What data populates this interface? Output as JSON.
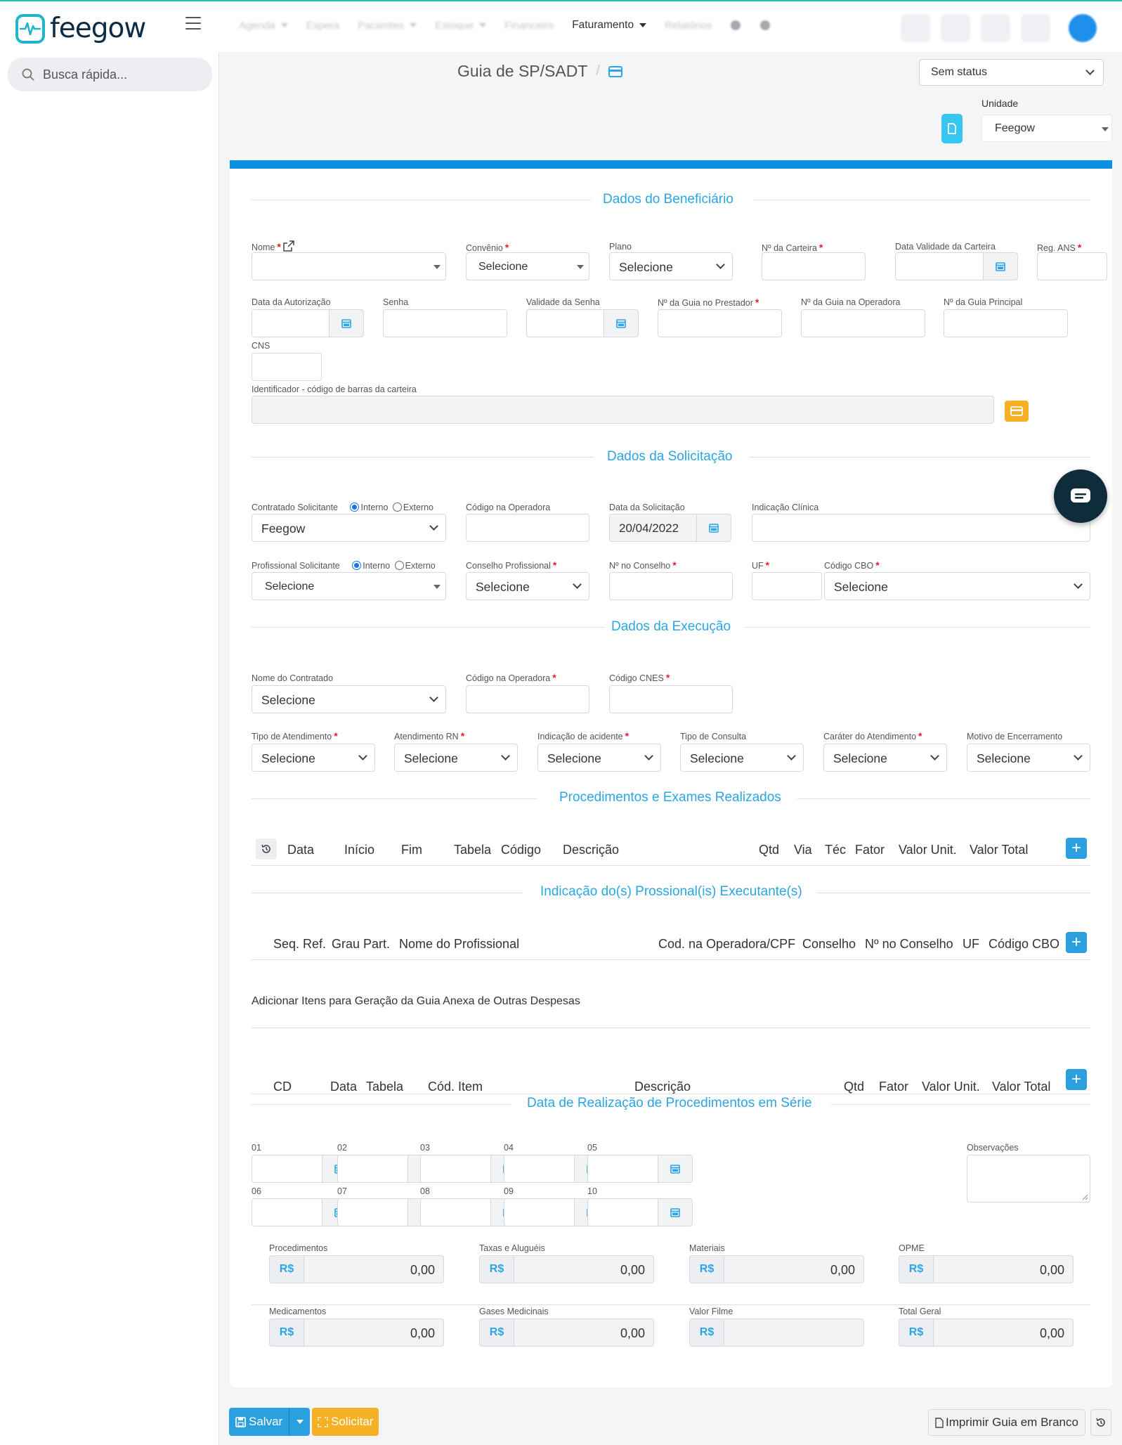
{
  "app": {
    "logo_text": "feegow",
    "brand_color": "#1fb6c9",
    "accent_color": "#2ba5e3"
  },
  "nav": {
    "items": [
      "Agenda",
      "Espera",
      "Pacientes",
      "Estoque",
      "Financeiro",
      "Faturamento",
      "Relatórios"
    ],
    "active": "Faturamento"
  },
  "sidebar": {
    "search_placeholder": "Busca rápida..."
  },
  "page": {
    "title": "Guia de SP/SADT",
    "status": "Sem status",
    "unidade_label": "Unidade",
    "unidade_value": "Feegow"
  },
  "sections": {
    "beneficiario": "Dados do Beneficiário",
    "solicitacao": "Dados da Solicitação",
    "execucao": "Dados da Execução",
    "procedimentos": "Procedimentos e Exames Realizados",
    "profissionais": "Indicação do(s) Prossional(is) Executante(s)",
    "serie": "Data de Realização de Procedimentos em Série"
  },
  "beneficiario": {
    "nome": "Nome",
    "convenio": "Convênio",
    "convenio_value": "Selecione",
    "plano": "Plano",
    "plano_value": "Selecione",
    "carteira": "Nº da Carteira",
    "validade_carteira": "Data Validade da Carteira",
    "reg_ans": "Reg. ANS",
    "data_autorizacao": "Data da Autorização",
    "senha": "Senha",
    "validade_senha": "Validade da Senha",
    "guia_prestador": "Nº da Guia no Prestador",
    "guia_operadora": "Nº da Guia na Operadora",
    "guia_principal": "Nº da Guia Principal",
    "cns": "CNS",
    "identificador": "Identificador - código de barras da carteira"
  },
  "solicitacao": {
    "contratado": "Contratado Solicitante",
    "interno": "Interno",
    "externo": "Externo",
    "contratado_value": "Feegow",
    "codigo_operadora": "Código na Operadora",
    "data_solicitacao": "Data da Solicitação",
    "data_solicitacao_value": "20/04/2022",
    "indicacao_clinica": "Indicação Clínica",
    "profissional": "Profissional Solicitante",
    "profissional_value": "Selecione",
    "conselho": "Conselho Profissional",
    "conselho_value": "Selecione",
    "n_conselho": "Nº no Conselho",
    "uf": "UF",
    "cbo": "Código CBO",
    "cbo_value": "Selecione"
  },
  "execucao": {
    "nome_contratado": "Nome do Contratado",
    "nome_contratado_value": "Selecione",
    "codigo_operadora": "Código na Operadora",
    "codigo_cnes": "Código CNES",
    "tipo_atendimento": "Tipo de Atendimento",
    "atendimento_rn": "Atendimento RN",
    "indicacao_acidente": "Indicação de acidente",
    "tipo_consulta": "Tipo de Consulta",
    "carater": "Caráter do Atendimento",
    "motivo": "Motivo de Encerramento",
    "selecione": "Selecione"
  },
  "procedimentos_cols": [
    "Data",
    "Início",
    "Fim",
    "Tabela",
    "Código",
    "Descrição",
    "Qtd",
    "Via",
    "Téc",
    "Fator",
    "Valor Unit.",
    "Valor Total"
  ],
  "profissionais_cols": [
    "Seq. Ref.",
    "Grau Part.",
    "Nome do Profissional",
    "Cod. na Operadora/CPF",
    "Conselho",
    "Nº no Conselho",
    "UF",
    "Código CBO"
  ],
  "despesas": {
    "title": "Adicionar Itens para Geração da Guia Anexa de Outras Despesas",
    "cols": [
      "CD",
      "Data",
      "Tabela",
      "Cód. Item",
      "Descrição",
      "Qtd",
      "Fator",
      "Valor Unit.",
      "Valor Total"
    ]
  },
  "serie": {
    "labels": [
      "01",
      "02",
      "03",
      "04",
      "05",
      "06",
      "07",
      "08",
      "09",
      "10"
    ],
    "observacoes": "Observações"
  },
  "totais": {
    "currency": "R$",
    "items": [
      {
        "label": "Procedimentos",
        "value": "0,00"
      },
      {
        "label": "Taxas e Aluguéis",
        "value": "0,00"
      },
      {
        "label": "Materiais",
        "value": "0,00"
      },
      {
        "label": "OPME",
        "value": "0,00"
      },
      {
        "label": "Medicamentos",
        "value": "0,00"
      },
      {
        "label": "Gases Medicinais",
        "value": "0,00"
      },
      {
        "label": "Valor Filme",
        "value": ""
      },
      {
        "label": "Total Geral",
        "value": "0,00"
      }
    ]
  },
  "footer": {
    "salvar": "Salvar",
    "solicitar": "Solicitar",
    "imprimir": "Imprimir Guia em Branco"
  }
}
